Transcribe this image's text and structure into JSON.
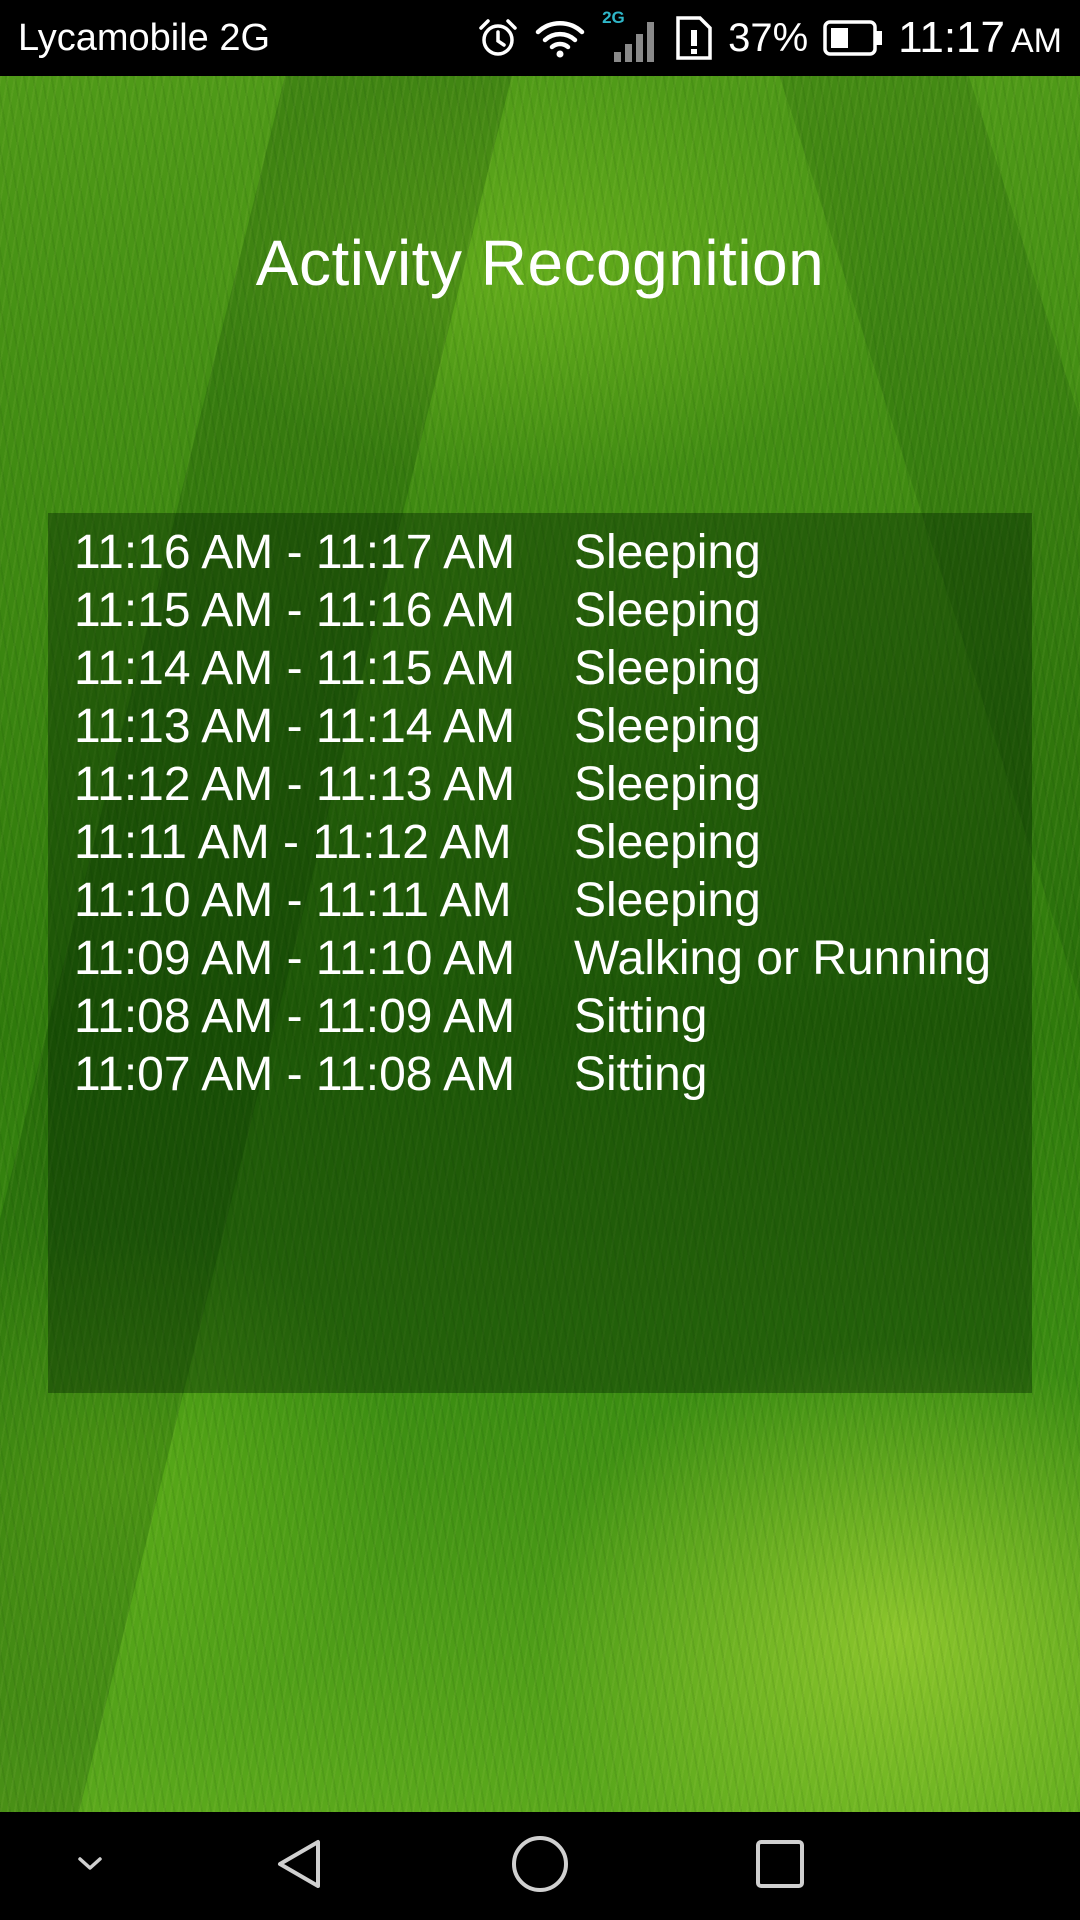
{
  "status_bar": {
    "carrier": "Lycamobile 2G",
    "network_badge": "2G",
    "battery_percent": "37%",
    "time": "11:17",
    "ampm": "AM",
    "icons": [
      "alarm-icon",
      "wifi-icon",
      "signal-icon",
      "sim-alert-icon",
      "battery-icon"
    ]
  },
  "app": {
    "title": "Activity Recognition"
  },
  "activity_log": [
    {
      "time_range": "11:16 AM - 11:17 AM",
      "activity": "Sleeping"
    },
    {
      "time_range": "11:15 AM - 11:16 AM",
      "activity": "Sleeping"
    },
    {
      "time_range": "11:14 AM - 11:15 AM",
      "activity": "Sleeping"
    },
    {
      "time_range": "11:13 AM - 11:14 AM",
      "activity": "Sleeping"
    },
    {
      "time_range": "11:12 AM - 11:13 AM",
      "activity": "Sleeping"
    },
    {
      "time_range": "11:11 AM - 11:12 AM",
      "activity": "Sleeping"
    },
    {
      "time_range": "11:10 AM - 11:11 AM",
      "activity": "Sleeping"
    },
    {
      "time_range": "11:09 AM - 11:10 AM",
      "activity": "Walking or Running"
    },
    {
      "time_range": "11:08 AM - 11:09 AM",
      "activity": "Sitting"
    },
    {
      "time_range": "11:07 AM - 11:08 AM",
      "activity": "Sitting"
    }
  ],
  "nav_bar": {
    "buttons": [
      "chevron-down-icon",
      "back-icon",
      "home-icon",
      "recents-icon"
    ]
  },
  "colors": {
    "status_bar_bg": "#000000",
    "text": "#ffffff",
    "network_badge": "#2fb7c9",
    "grass_base": "#3f8a12"
  }
}
